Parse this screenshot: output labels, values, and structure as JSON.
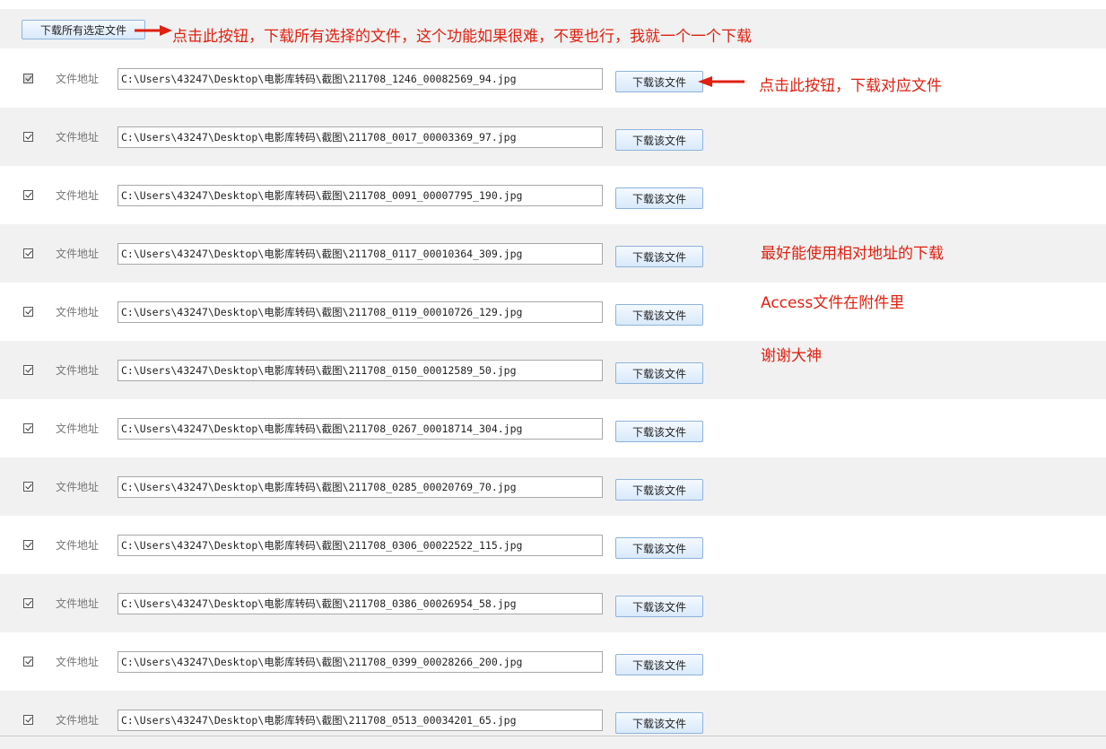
{
  "header": {
    "download_all_label": "下载所有选定文件",
    "annotation": "点击此按钮，下载所有选择的文件，这个功能如果很难，不要也行，我就一个一个下载"
  },
  "row_annotation": "点击此按钮，下载对应文件",
  "side_notes": [
    "最好能使用相对地址的下载",
    "Access文件在附件里",
    "谢谢大神"
  ],
  "field_label": "文件地址",
  "download_label": "下载该文件",
  "rows": [
    {
      "path": "C:\\Users\\43247\\Desktop\\电影库转码\\截图\\211708_1246_00082569_94.jpg",
      "checked": true
    },
    {
      "path": "C:\\Users\\43247\\Desktop\\电影库转码\\截图\\211708_0017_00003369_97.jpg",
      "checked": true
    },
    {
      "path": "C:\\Users\\43247\\Desktop\\电影库转码\\截图\\211708_0091_00007795_190.jpg",
      "checked": true
    },
    {
      "path": "C:\\Users\\43247\\Desktop\\电影库转码\\截图\\211708_0117_00010364_309.jpg",
      "checked": true
    },
    {
      "path": "C:\\Users\\43247\\Desktop\\电影库转码\\截图\\211708_0119_00010726_129.jpg",
      "checked": true
    },
    {
      "path": "C:\\Users\\43247\\Desktop\\电影库转码\\截图\\211708_0150_00012589_50.jpg",
      "checked": true
    },
    {
      "path": "C:\\Users\\43247\\Desktop\\电影库转码\\截图\\211708_0267_00018714_304.jpg",
      "checked": true
    },
    {
      "path": "C:\\Users\\43247\\Desktop\\电影库转码\\截图\\211708_0285_00020769_70.jpg",
      "checked": true
    },
    {
      "path": "C:\\Users\\43247\\Desktop\\电影库转码\\截图\\211708_0306_00022522_115.jpg",
      "checked": true
    },
    {
      "path": "C:\\Users\\43247\\Desktop\\电影库转码\\截图\\211708_0386_00026954_58.jpg",
      "checked": true
    },
    {
      "path": "C:\\Users\\43247\\Desktop\\电影库转码\\截图\\211708_0399_00028266_200.jpg",
      "checked": true
    },
    {
      "path": "C:\\Users\\43247\\Desktop\\电影库转码\\截图\\211708_0513_00034201_65.jpg",
      "checked": true
    }
  ],
  "colors": {
    "annotation": "#e02010",
    "stripe": "#f1f1f1",
    "button_border": "#8eb3dc"
  }
}
